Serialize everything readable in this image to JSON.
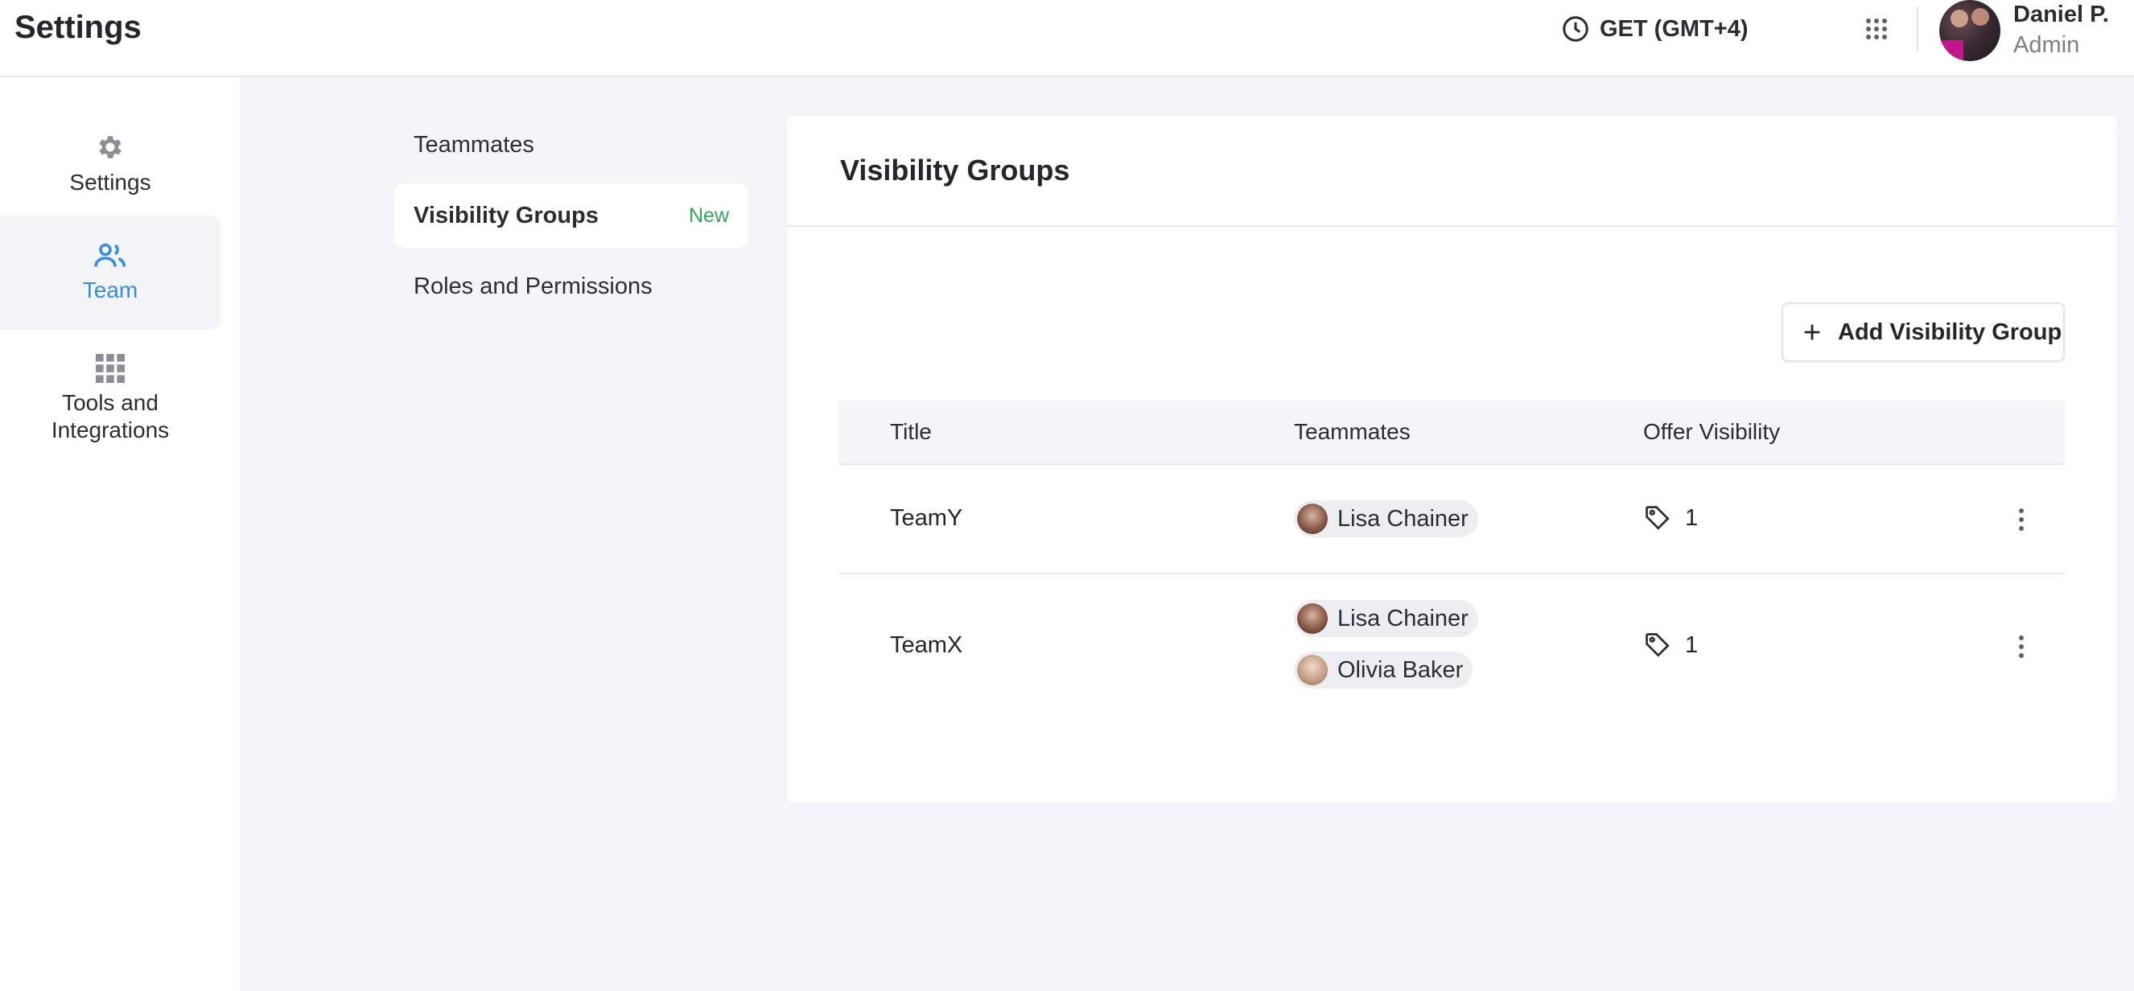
{
  "header": {
    "title": "Settings",
    "timezone": "GET (GMT+4)",
    "user": {
      "name": "Daniel P.",
      "role": "Admin"
    }
  },
  "rail": {
    "items": [
      {
        "label": "Settings",
        "icon": "gear-icon",
        "active": false
      },
      {
        "label": "Team",
        "icon": "team-icon",
        "active": true
      },
      {
        "label": "Tools and Integrations",
        "icon": "grid-icon",
        "active": false
      }
    ]
  },
  "subnav": {
    "items": [
      {
        "label": "Teammates"
      },
      {
        "label": "Visibility Groups",
        "badge": "New"
      },
      {
        "label": "Roles and Permissions"
      }
    ]
  },
  "panel": {
    "title": "Visibility Groups",
    "add_label": "Add Visibility Group",
    "columns": [
      "Title",
      "Teammates",
      "Offer Visibility"
    ],
    "rows": [
      {
        "title": "TeamY",
        "teammates": [
          "Lisa Chainer"
        ],
        "offers": "1"
      },
      {
        "title": "TeamX",
        "teammates": [
          "Lisa Chainer",
          "Olivia Baker"
        ],
        "offers": "1"
      }
    ]
  },
  "colors": {
    "accent": "#3a8ddd",
    "badge": "#3aa35a",
    "background": "#f4f5f8"
  }
}
